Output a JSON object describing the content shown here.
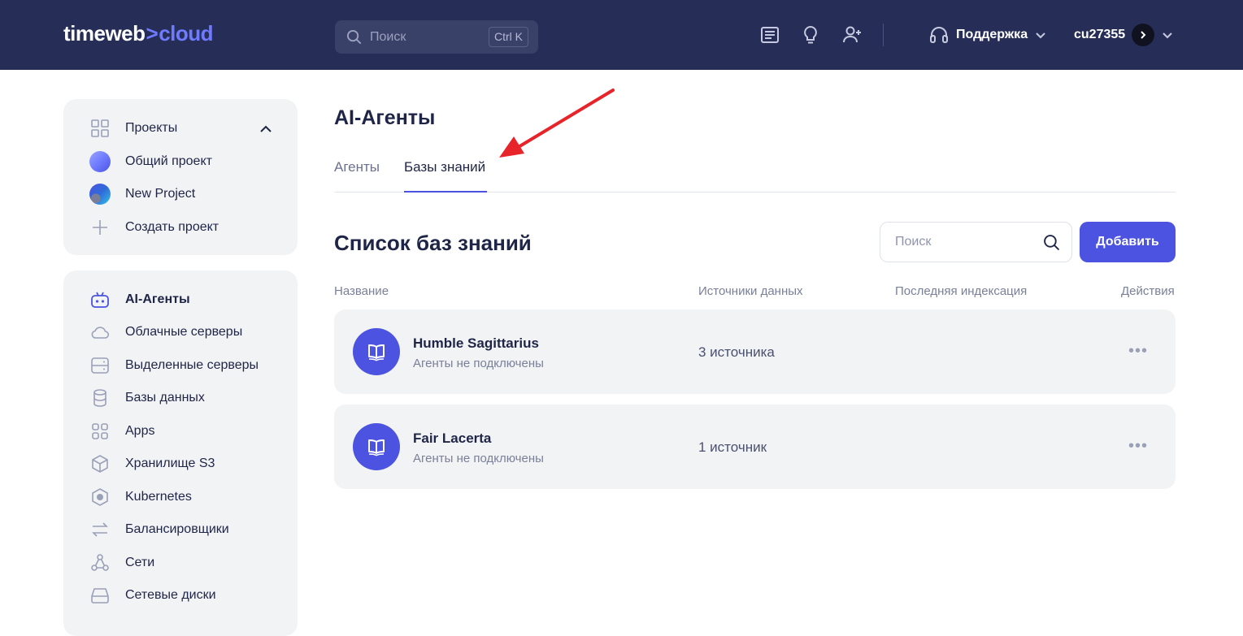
{
  "header": {
    "logo_main": "timeweb",
    "logo_sep": ">",
    "logo_accent": "cloud",
    "search_placeholder": "Поиск",
    "search_shortcut": "Ctrl K",
    "support_label": "Поддержка",
    "user_name": "cu27355",
    "icons": [
      "news-icon",
      "lightbulb-icon",
      "add-user-icon",
      "headset-icon"
    ]
  },
  "projects": {
    "title": "Проекты",
    "items": [
      {
        "label": "Общий проект"
      },
      {
        "label": "New Project"
      }
    ],
    "create_label": "Создать проект"
  },
  "nav": {
    "items": [
      {
        "label": "AI-Агенты",
        "icon": "robot-icon",
        "active": true
      },
      {
        "label": "Облачные серверы",
        "icon": "cloud-icon"
      },
      {
        "label": "Выделенные серверы",
        "icon": "server-icon"
      },
      {
        "label": "Базы данных",
        "icon": "database-icon"
      },
      {
        "label": "Apps",
        "icon": "apps-icon"
      },
      {
        "label": "Хранилище S3",
        "icon": "cube-icon"
      },
      {
        "label": "Kubernetes",
        "icon": "kubernetes-icon"
      },
      {
        "label": "Балансировщики",
        "icon": "balancer-icon"
      },
      {
        "label": "Сети",
        "icon": "network-icon"
      },
      {
        "label": "Сетевые диски",
        "icon": "disk-icon"
      }
    ]
  },
  "main": {
    "title": "AI-Агенты",
    "tabs": [
      {
        "label": "Агенты",
        "active": false
      },
      {
        "label": "Базы знаний",
        "active": true
      }
    ],
    "list_title": "Список баз знаний",
    "search_placeholder": "Поиск",
    "add_button": "Добавить",
    "columns": [
      "Название",
      "Источники данных",
      "Последняя индексация",
      "Действия"
    ],
    "rows": [
      {
        "name": "Humble Sagittarius",
        "status": "Агенты не подключены",
        "sources": "3 источника",
        "last_index": ""
      },
      {
        "name": "Fair Lacerta",
        "status": "Агенты не подключены",
        "sources": "1 источник",
        "last_index": ""
      }
    ]
  },
  "colors": {
    "header_bg": "#262e58",
    "accent": "#4b53e0",
    "annotation_arrow": "#e8242b"
  }
}
